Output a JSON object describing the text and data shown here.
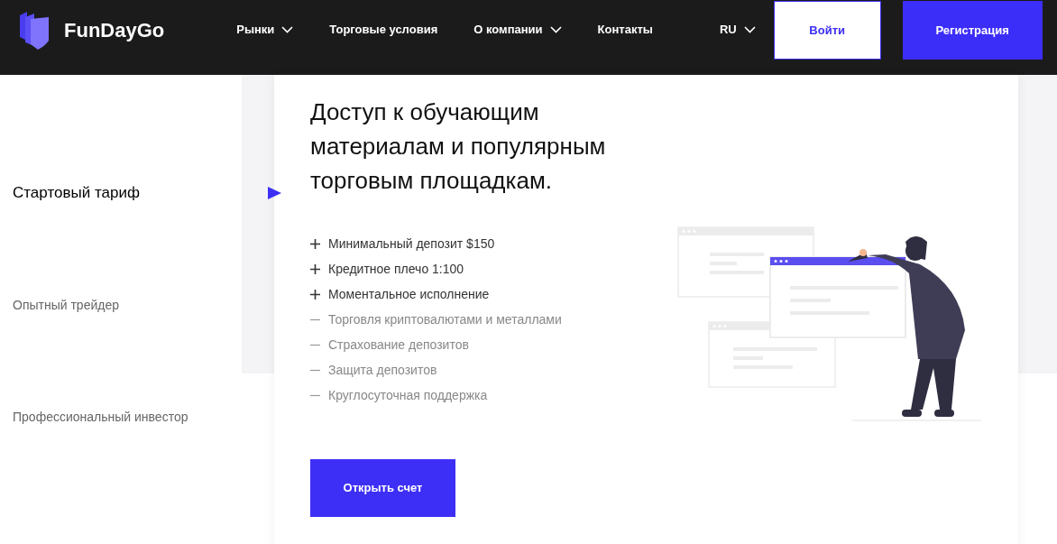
{
  "header": {
    "logo": "FunDayGo",
    "nav": [
      {
        "label": "Рынки",
        "dropdown": true
      },
      {
        "label": "Торговые условия",
        "dropdown": false
      },
      {
        "label": "О компании",
        "dropdown": true
      },
      {
        "label": "Контакты",
        "dropdown": false
      }
    ],
    "language": "RU",
    "login": "Войти",
    "register": "Регистрация"
  },
  "tariffs": [
    {
      "label": "Стартовый тариф",
      "selected": true
    },
    {
      "label": "Опытный трейдер",
      "selected": false
    },
    {
      "label": "Профессиональный инвестор",
      "selected": false
    }
  ],
  "plan": {
    "heading": "Доступ к обучающим материалам и популярным торговым площадкам.",
    "features": [
      {
        "text": "Минимальный депозит $150",
        "included": true
      },
      {
        "text": "Кредитное плечо 1:100",
        "included": true
      },
      {
        "text": "Моментальное исполнение",
        "included": true
      },
      {
        "text": "Торговля криптовалютами и металлами",
        "included": false
      },
      {
        "text": "Страхование депозитов",
        "included": false
      },
      {
        "text": "Защита депозитов",
        "included": false
      },
      {
        "text": "Круглосуточная поддержка",
        "included": false
      }
    ],
    "button": "Открыть счет"
  }
}
